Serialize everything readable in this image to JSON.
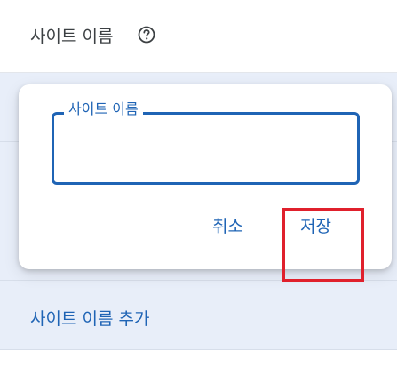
{
  "header": {
    "label": "사이트 이름",
    "help_icon": "help-circle-icon"
  },
  "dialog": {
    "field_legend": "사이트 이름",
    "field_value": "",
    "cancel_label": "취소",
    "save_label": "저장"
  },
  "add_site_name_label": "사이트 이름 추가",
  "colors": {
    "accent": "#1f64b5",
    "row_band": "#e8eef9",
    "highlight": "#e0202c"
  }
}
